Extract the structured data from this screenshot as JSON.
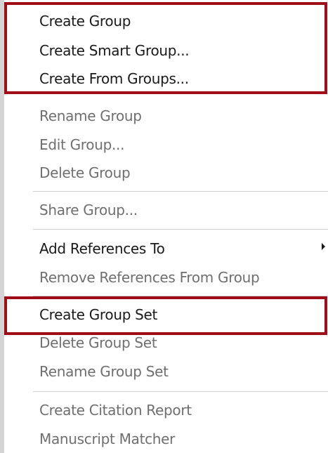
{
  "menu": {
    "create_group": "Create Group",
    "create_smart_group": "Create Smart Group...",
    "create_from_groups": "Create From Groups...",
    "rename_group": "Rename Group",
    "edit_group": "Edit Group...",
    "delete_group": "Delete Group",
    "share_group": "Share Group...",
    "add_references_to": "Add References To",
    "remove_references_from_group": "Remove References From Group",
    "create_group_set": "Create Group Set",
    "delete_group_set": "Delete Group Set",
    "rename_group_set": "Rename Group Set",
    "create_citation_report": "Create Citation Report",
    "manuscript_matcher": "Manuscript Matcher"
  },
  "colors": {
    "highlight_border": "#a00d16",
    "enabled_text": "#1a1a1a",
    "disabled_text": "#6f6f6f",
    "separator": "#d0d0d0"
  },
  "icons": {
    "submenu": "chevron-right-icon"
  }
}
